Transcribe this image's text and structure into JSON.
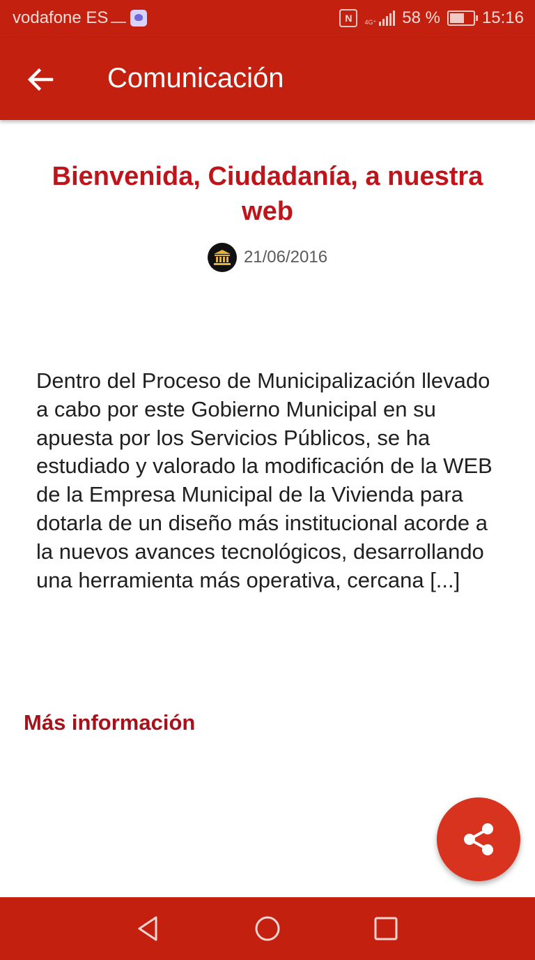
{
  "status_bar": {
    "carrier": "vodafone ES",
    "network": "4G⁺",
    "battery": "58 %",
    "time": "15:16"
  },
  "app_bar": {
    "title": "Comunicación"
  },
  "article": {
    "title": "Bienvenida, Ciudadanía, a nuestra web",
    "date": "21/06/2016",
    "body": "Dentro del Proceso de Municipalización llevado a cabo por este Gobierno Municipal en su apuesta por los Servicios Públicos, se ha estudiado y valorado la modificación de la WEB de la Empresa Municipal de la Vivienda para dotarla de un diseño más institucional acorde a la nuevos avances tecnológicos, desarrollando una herramienta más operativa, cercana [...]",
    "more_link": "Más información"
  },
  "colors": {
    "primary": "#c4200f",
    "title_red": "#c0141b",
    "fab": "#d7331f"
  },
  "icons": {
    "back": "arrow-left-icon",
    "author": "bank-icon",
    "share": "share-icon",
    "nav_back": "triangle-back-icon",
    "nav_home": "circle-home-icon",
    "nav_recents": "square-recents-icon"
  }
}
